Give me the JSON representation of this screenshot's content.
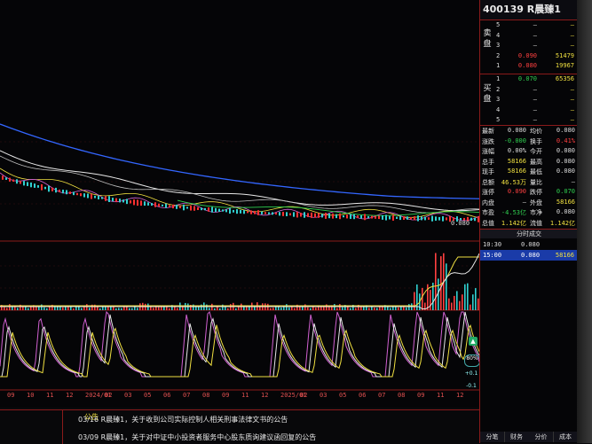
{
  "stock": {
    "code": "400139",
    "name": "R晨臻1"
  },
  "orderbook": {
    "sell_label": "卖盘",
    "buy_label": "买盘",
    "sell": [
      {
        "level": "5",
        "price": "–",
        "vol": "–"
      },
      {
        "level": "4",
        "price": "–",
        "vol": "–"
      },
      {
        "level": "3",
        "price": "–",
        "vol": "–"
      },
      {
        "level": "2",
        "price": "0.090",
        "vol": "51479"
      },
      {
        "level": "1",
        "price": "0.080",
        "vol": "19967"
      }
    ],
    "buy": [
      {
        "level": "1",
        "price": "0.070",
        "vol": "65356"
      },
      {
        "level": "2",
        "price": "–",
        "vol": "–"
      },
      {
        "level": "3",
        "price": "–",
        "vol": "–"
      },
      {
        "level": "4",
        "price": "–",
        "vol": "–"
      },
      {
        "level": "5",
        "price": "–",
        "vol": "–"
      }
    ]
  },
  "stats": [
    {
      "l1": "最新",
      "v1": "0.080",
      "l2": "均价",
      "v2": "0.080"
    },
    {
      "l1": "涨跌",
      "v1": "-0.000",
      "l2": "换手",
      "v2": "0.41%"
    },
    {
      "l1": "涨幅",
      "v1": "0.00%",
      "l2": "今开",
      "v2": "0.080"
    },
    {
      "l1": "总手",
      "v1": "58166",
      "l2": "最高",
      "v2": "0.080"
    },
    {
      "l1": "现手",
      "v1": "58166",
      "l2": "最低",
      "v2": "0.080"
    },
    {
      "l1": "总额",
      "v1": "46.53万",
      "l2": "量比",
      "v2": "–"
    },
    {
      "l1": "涨停",
      "v1": "0.090",
      "l2": "跌停",
      "v2": "0.070"
    },
    {
      "l1": "内盘",
      "v1": "–",
      "l2": "外盘",
      "v2": "58166"
    },
    {
      "l1": "市盈",
      "v1": "-4.53亿",
      "l2": "市净",
      "v2": "0.080"
    },
    {
      "l1": "总值",
      "v1": "1.142亿",
      "l2": "流值",
      "v2": "1.142亿"
    }
  ],
  "tick_header": "分时成交",
  "ticks": [
    {
      "time": "10:30",
      "price": "0.080",
      "vol": ""
    },
    {
      "time": "15:00",
      "price": "0.080",
      "vol": "58166"
    }
  ],
  "side_tabs": [
    "分笔",
    "财务",
    "分价",
    "成本"
  ],
  "news": {
    "header": "公告",
    "items": [
      {
        "date": "03/16",
        "title": "R晨臻1，关于收到公司实际控制人相关刑事法律文书的公告"
      },
      {
        "date": "03/09",
        "title": "R晨臻1，关于对中证中小投资者服务中心股东质询建议函回复的公告"
      }
    ]
  },
  "axis": {
    "x_labels": [
      "09",
      "10",
      "11",
      "12",
      "2024/01",
      "02",
      "03",
      "05",
      "06",
      "07",
      "08",
      "09",
      "11",
      "12",
      "2025/01",
      "02",
      "03",
      "05",
      "06",
      "07",
      "08",
      "09",
      "11",
      "12"
    ],
    "price_low_label": "0.080"
  },
  "tools": {
    "zoom": "80%",
    "plus": "+0.1",
    "minus": "-0.1"
  },
  "colors": {
    "up": "#ff3030",
    "down": "#30d050",
    "accent": "#f0e040",
    "ma_long": "#3366ff",
    "frame": "#8a1a1a"
  }
}
